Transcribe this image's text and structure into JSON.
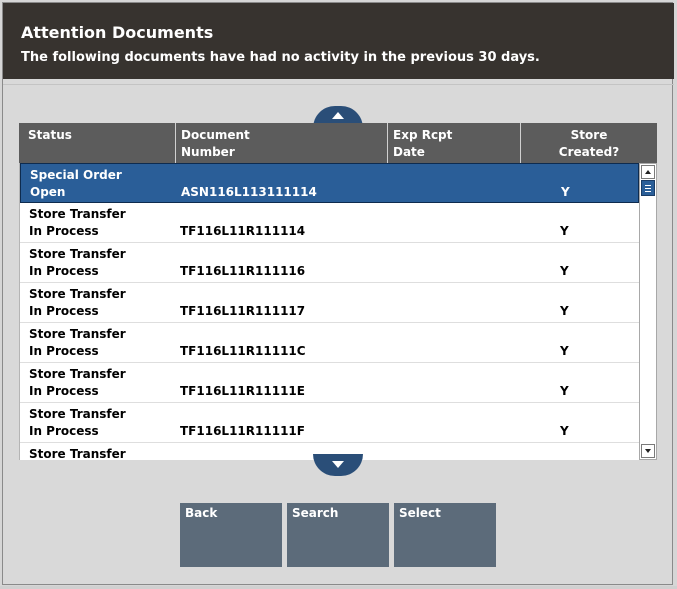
{
  "header": {
    "title": "Attention Documents",
    "subtitle": "The following documents have had no activity in the previous 30 days."
  },
  "grid": {
    "columns": [
      {
        "line1": "Status",
        "line2": ""
      },
      {
        "line1": "Document",
        "line2": "Number"
      },
      {
        "line1": "Exp Rcpt",
        "line2": "Date"
      },
      {
        "line1": "Store",
        "line2": "Created?"
      }
    ],
    "rows": [
      {
        "type": "Special Order",
        "state": "Open",
        "doc": "ASN116L113111114",
        "date": "",
        "store": "Y"
      },
      {
        "type": "Store Transfer",
        "state": "In Process",
        "doc": "TF116L11R111114",
        "date": "",
        "store": "Y"
      },
      {
        "type": "Store Transfer",
        "state": "In Process",
        "doc": "TF116L11R111116",
        "date": "",
        "store": "Y"
      },
      {
        "type": "Store Transfer",
        "state": "In Process",
        "doc": "TF116L11R111117",
        "date": "",
        "store": "Y"
      },
      {
        "type": "Store Transfer",
        "state": "In Process",
        "doc": "TF116L11R11111C",
        "date": "",
        "store": "Y"
      },
      {
        "type": "Store Transfer",
        "state": "In Process",
        "doc": "TF116L11R11111E",
        "date": "",
        "store": "Y"
      },
      {
        "type": "Store Transfer",
        "state": "In Process",
        "doc": "TF116L11R11111F",
        "date": "",
        "store": "Y"
      },
      {
        "type": "Store Transfer",
        "state": "",
        "doc": "",
        "date": "",
        "store": ""
      }
    ]
  },
  "buttons": {
    "back": "Back",
    "search": "Search",
    "select": "Select"
  },
  "colors": {
    "header_bg": "#37332f",
    "selected_row": "#2a5e98",
    "button_bg": "#5c6b7a",
    "scroll_tab": "#2a4e78"
  }
}
